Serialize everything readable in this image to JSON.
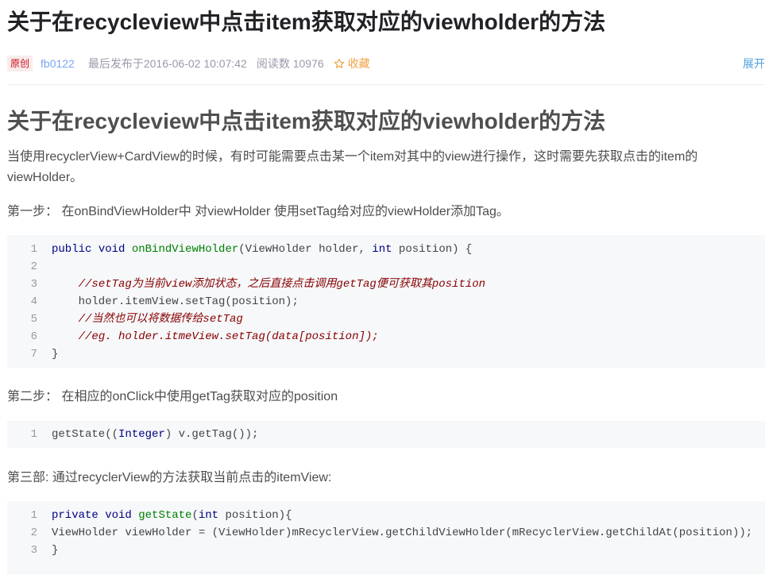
{
  "colors": {
    "title": "#222226",
    "heading": "#4f4f4f",
    "text": "#4d4d4d",
    "meta": "#999aaa",
    "author": "#78a5f1",
    "badge_text": "#ca0c16",
    "badge_bg": "#f9ecec",
    "collect": "#f1a243",
    "expand": "#4ea1db",
    "divider": "#ededed",
    "code_bg": "#f6f8fa",
    "line_number": "#999999",
    "keyword": "#000080",
    "function": "#008000",
    "comment": "#880000",
    "code_text": "#444444"
  },
  "article": {
    "title": "关于在recycleview中点击item获取对应的viewholder的方法",
    "meta": {
      "badge": "原创",
      "author": "fb0122",
      "published_label": "最后发布于",
      "published_at": "2016-06-02 10:07:42",
      "reads_label": "阅读数",
      "reads_count": "10976",
      "collect": {
        "icon": "star-outline-icon",
        "label": "收藏"
      },
      "expand_label": "展开"
    }
  },
  "content": {
    "heading": "关于在recycleview中点击item获取对应的viewholder的方法",
    "intro": "当使用recyclerView+CardView的时候，有时可能需要点击某一个item对其中的view进行操作，这时需要先获取点击的item的viewHolder。",
    "step1": "第一步： 在onBindViewHolder中 对viewHolder 使用setTag给对应的viewHolder添加Tag。",
    "step2": "第二步： 在相应的onClick中使用getTag获取对应的position",
    "step3": "第三部: 通过recyclerView的方法获取当前点击的itemView:"
  },
  "code_blocks": [
    {
      "lines": [
        {
          "n": "1",
          "tokens": [
            {
              "keyword": "public"
            },
            {
              "plain": " "
            },
            {
              "keyword": "void"
            },
            {
              "plain": " "
            },
            {
              "function": "onBindViewHolder"
            },
            {
              "plain": "(ViewHolder holder, "
            },
            {
              "keyword": "int"
            },
            {
              "plain": " position) {"
            }
          ]
        },
        {
          "n": "2",
          "tokens": []
        },
        {
          "n": "3",
          "tokens": [
            {
              "plain": "    "
            },
            {
              "comment": "//setTag为当前view添加状态，之后直接点击调用getTag便可获取其position"
            }
          ]
        },
        {
          "n": "4",
          "tokens": [
            {
              "plain": "    holder.itemView.setTag(position);"
            }
          ]
        },
        {
          "n": "5",
          "tokens": [
            {
              "plain": "    "
            },
            {
              "comment": "//当然也可以将数据传给setTag"
            }
          ]
        },
        {
          "n": "6",
          "tokens": [
            {
              "plain": "    "
            },
            {
              "comment": "//eg. holder.itmeView.setTag(data[position]);"
            }
          ]
        },
        {
          "n": "7",
          "tokens": [
            {
              "plain": "}"
            }
          ]
        }
      ]
    },
    {
      "lines": [
        {
          "n": "1",
          "tokens": [
            {
              "plain": "getState(("
            },
            {
              "keyword": "Integer"
            },
            {
              "plain": ") v.getTag());"
            }
          ]
        }
      ]
    },
    {
      "lines": [
        {
          "n": "1",
          "tokens": [
            {
              "keyword": "private"
            },
            {
              "plain": " "
            },
            {
              "keyword": "void"
            },
            {
              "plain": " "
            },
            {
              "function": "getState"
            },
            {
              "plain": "("
            },
            {
              "keyword": "int"
            },
            {
              "plain": " position){"
            }
          ]
        },
        {
          "n": "2",
          "tokens": [
            {
              "plain": "ViewHolder viewHolder = (ViewHolder)mRecyclerView.getChildViewHolder(mRecyclerView.getChildAt(position));"
            }
          ]
        },
        {
          "n": "3",
          "tokens": [
            {
              "plain": "}"
            }
          ]
        }
      ]
    }
  ]
}
